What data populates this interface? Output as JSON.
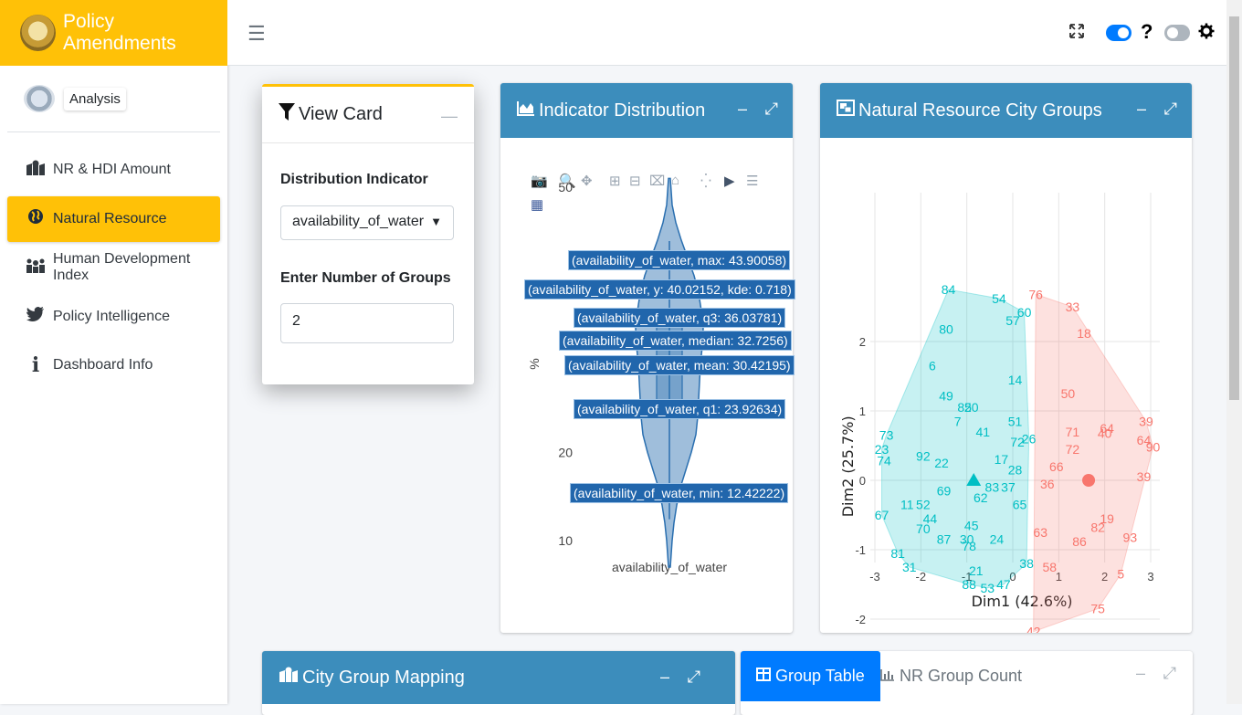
{
  "brand": {
    "title": "Policy Amendments"
  },
  "user": {
    "name": "Analysis"
  },
  "nav": [
    {
      "label": "NR & HDI Amount",
      "icon": "map-marked-icon"
    },
    {
      "label": "Natural Resource",
      "icon": "globe-icon",
      "active": true
    },
    {
      "label": "Human Development Index",
      "icon": "people-icon"
    },
    {
      "label": "Policy Intelligence",
      "icon": "twitter-icon"
    },
    {
      "label": "Dashboard Info",
      "icon": "info-icon"
    }
  ],
  "topbar": {
    "help": "?"
  },
  "view_card": {
    "title": "View Card",
    "indicator_label": "Distribution Indicator",
    "indicator_value": "availability_of_water",
    "groups_label": "Enter Number of Groups",
    "groups_value": "2"
  },
  "dist_card": {
    "title": "Indicator Distribution",
    "hover_labels": [
      "(availability_of_water, max: 43.90058)",
      "(availability_of_water, y: 40.02152, kde: 0.718)",
      "(availability_of_water, q3: 36.03781)",
      "(availability_of_water, median: 32.7256)",
      "(availability_of_water, mean: 30.42195)",
      "(availability_of_water, q1: 23.92634)",
      "(availability_of_water, min: 12.42222)"
    ]
  },
  "nr_card": {
    "title": "Natural Resource City Groups"
  },
  "map_card": {
    "title": "City Group Mapping"
  },
  "table_card": {
    "tab_active": "Group Table",
    "tab_other": "NR Group Count"
  },
  "colors": {
    "brand": "#ffc107",
    "header_blue": "#3c8dbc",
    "tab_blue": "#007bff",
    "cluster1": "#00bfc4",
    "cluster2": "#f8766d",
    "violin": "#2a6fb0"
  },
  "chart_data": [
    {
      "type": "violin",
      "xlabel": "",
      "ylabel": "%",
      "categories": [
        "availability_of_water"
      ],
      "yticks": [
        10,
        20,
        50
      ],
      "ylim": [
        5,
        52
      ],
      "stats": {
        "max": 43.90058,
        "q3": 36.03781,
        "median": 32.7256,
        "mean": 30.42195,
        "q1": 23.92634,
        "min": 12.42222,
        "hover_y": 40.02152,
        "hover_kde": 0.718
      }
    },
    {
      "type": "scatter",
      "xlabel": "Dim1 (42.6%)",
      "ylabel": "Dim2 (25.7%)",
      "xlim": [
        -3.1,
        3.3
      ],
      "ylim": [
        -2.3,
        2.75
      ],
      "xticks": [
        -3,
        -2,
        -1,
        0,
        1,
        2,
        3
      ],
      "yticks": [
        -2,
        -1,
        0,
        1,
        2
      ],
      "series": [
        {
          "cluster": 1,
          "centroid": [
            -0.85,
            0.0
          ],
          "points": [
            {
              "l": "84",
              "x": -1.4,
              "y": 2.75
            },
            {
              "l": "54",
              "x": -0.3,
              "y": 2.62
            },
            {
              "l": "57",
              "x": 0.0,
              "y": 2.3
            },
            {
              "l": "60",
              "x": 0.25,
              "y": 2.42
            },
            {
              "l": "80",
              "x": -1.45,
              "y": 2.18
            },
            {
              "l": "6",
              "x": -1.75,
              "y": 1.65
            },
            {
              "l": "14",
              "x": 0.05,
              "y": 1.45
            },
            {
              "l": "49",
              "x": -1.45,
              "y": 1.22
            },
            {
              "l": "85",
              "x": -1.05,
              "y": 1.05
            },
            {
              "l": "20",
              "x": -0.9,
              "y": 1.05
            },
            {
              "l": "7",
              "x": -1.2,
              "y": 0.85
            },
            {
              "l": "41",
              "x": -0.65,
              "y": 0.7
            },
            {
              "l": "51",
              "x": 0.05,
              "y": 0.85
            },
            {
              "l": "73",
              "x": -2.75,
              "y": 0.65
            },
            {
              "l": "23",
              "x": -2.85,
              "y": 0.45
            },
            {
              "l": "74",
              "x": -2.8,
              "y": 0.28
            },
            {
              "l": "92",
              "x": -1.95,
              "y": 0.35
            },
            {
              "l": "22",
              "x": -1.55,
              "y": 0.25
            },
            {
              "l": "72",
              "x": 0.1,
              "y": 0.55
            },
            {
              "l": "26",
              "x": 0.35,
              "y": 0.6
            },
            {
              "l": "17",
              "x": -0.25,
              "y": 0.3
            },
            {
              "l": "28",
              "x": 0.05,
              "y": 0.15
            },
            {
              "l": "69",
              "x": -1.5,
              "y": -0.15
            },
            {
              "l": "83",
              "x": -0.45,
              "y": -0.1
            },
            {
              "l": "37",
              "x": -0.1,
              "y": -0.1
            },
            {
              "l": "62",
              "x": -0.7,
              "y": -0.25
            },
            {
              "l": "65",
              "x": 0.15,
              "y": -0.35
            },
            {
              "l": "67",
              "x": -2.85,
              "y": -0.5
            },
            {
              "l": "11",
              "x": -2.3,
              "y": -0.35
            },
            {
              "l": "52",
              "x": -1.95,
              "y": -0.35
            },
            {
              "l": "44",
              "x": -1.8,
              "y": -0.55
            },
            {
              "l": "70",
              "x": -1.95,
              "y": -0.7
            },
            {
              "l": "45",
              "x": -0.9,
              "y": -0.65
            },
            {
              "l": "30",
              "x": -1.0,
              "y": -0.85
            },
            {
              "l": "87",
              "x": -1.5,
              "y": -0.85
            },
            {
              "l": "78",
              "x": -0.95,
              "y": -0.95
            },
            {
              "l": "24",
              "x": -0.35,
              "y": -0.85
            },
            {
              "l": "81",
              "x": -2.5,
              "y": -1.05
            },
            {
              "l": "31",
              "x": -2.25,
              "y": -1.25
            },
            {
              "l": "38",
              "x": 0.3,
              "y": -1.2
            },
            {
              "l": "21",
              "x": -0.8,
              "y": -1.3
            },
            {
              "l": "88",
              "x": -0.95,
              "y": -1.5
            },
            {
              "l": "53",
              "x": -0.55,
              "y": -1.55
            },
            {
              "l": "47",
              "x": -0.2,
              "y": -1.5
            }
          ]
        },
        {
          "cluster": 2,
          "centroid": [
            1.65,
            0.0
          ],
          "points": [
            {
              "l": "76",
              "x": 0.5,
              "y": 2.68
            },
            {
              "l": "33",
              "x": 1.3,
              "y": 2.5
            },
            {
              "l": "18",
              "x": 1.55,
              "y": 2.12
            },
            {
              "l": "50",
              "x": 1.2,
              "y": 1.25
            },
            {
              "l": "71",
              "x": 1.3,
              "y": 0.7
            },
            {
              "l": "72",
              "x": 1.3,
              "y": 0.45
            },
            {
              "l": "64",
              "x": 2.05,
              "y": 0.75
            },
            {
              "l": "40",
              "x": 2.0,
              "y": 0.68
            },
            {
              "l": "39",
              "x": 2.9,
              "y": 0.85
            },
            {
              "l": "64",
              "x": 2.85,
              "y": 0.58
            },
            {
              "l": "90",
              "x": 3.05,
              "y": 0.48
            },
            {
              "l": "66",
              "x": 0.95,
              "y": 0.2
            },
            {
              "l": "36",
              "x": 0.75,
              "y": -0.05
            },
            {
              "l": "39",
              "x": 2.85,
              "y": 0.05
            },
            {
              "l": "19",
              "x": 2.05,
              "y": -0.55
            },
            {
              "l": "82",
              "x": 1.85,
              "y": -0.68
            },
            {
              "l": "93",
              "x": 2.55,
              "y": -0.82
            },
            {
              "l": "63",
              "x": 0.6,
              "y": -0.75
            },
            {
              "l": "86",
              "x": 1.45,
              "y": -0.88
            },
            {
              "l": "58",
              "x": 0.8,
              "y": -1.25
            },
            {
              "l": "5",
              "x": 2.35,
              "y": -1.35
            },
            {
              "l": "75",
              "x": 1.85,
              "y": -1.85
            },
            {
              "l": "42",
              "x": 0.45,
              "y": -2.18
            }
          ]
        }
      ]
    }
  ]
}
